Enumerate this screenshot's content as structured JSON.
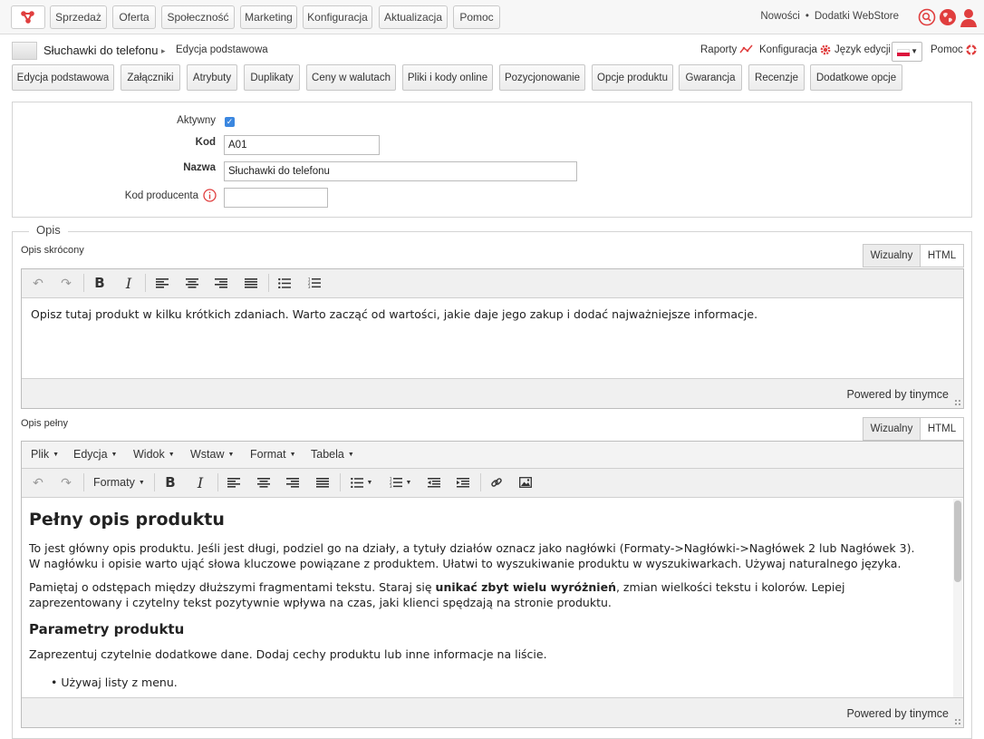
{
  "topnav": {
    "items": [
      "Sprzedaż",
      "Oferta",
      "Społeczność",
      "Marketing",
      "Konfiguracja",
      "Aktualizacja",
      "Pomoc"
    ],
    "news": "Nowości",
    "separator": "•",
    "addons": "Dodatki WebStore",
    "icons": [
      "logo-icon",
      "search-icon",
      "globe-icon",
      "user-icon"
    ],
    "accent": "#e03e3e"
  },
  "product_header": {
    "name": "Słuchawki do telefonu",
    "arrow": "▸",
    "section": "Edycja podstawowa",
    "reports": "Raporty",
    "config": "Konfiguracja",
    "lang_label": "Język edycji",
    "help": "Pomoc"
  },
  "tabs": [
    "Edycja podstawowa",
    "Załączniki",
    "Atrybuty",
    "Duplikaty",
    "Ceny w walutach",
    "Pliki i kody online",
    "Pozycjonowanie",
    "Opcje produktu",
    "Gwarancja",
    "Recenzje",
    "Dodatkowe opcje"
  ],
  "form": {
    "active_label": "Aktywny",
    "active_checked": true,
    "code_label": "Kod",
    "code_value": "A01",
    "name_label": "Nazwa",
    "name_value": "Słuchawki do telefonu",
    "producer_code_label": "Kod producenta",
    "producer_code_value": ""
  },
  "opis": {
    "legend": "Opis",
    "short": {
      "label": "Opis skrócony",
      "mode_visual": "Wizualny",
      "mode_html": "HTML",
      "text": "Opisz tutaj produkt w kilku krótkich zdaniach. Warto zacząć od wartości, jakie daje jego zakup i dodać najważniejsze informacje.",
      "powered": "Powered by tinymce"
    },
    "full": {
      "label": "Opis pełny",
      "mode_visual": "Wizualny",
      "mode_html": "HTML",
      "menu": [
        "Plik",
        "Edycja",
        "Widok",
        "Wstaw",
        "Format",
        "Tabela"
      ],
      "formats": "Formaty",
      "heading": "Pełny opis produktu",
      "p1": "To jest główny opis produktu. Jeśli jest długi, podziel go na działy, a tytuły działów oznacz jako nagłówki (Formaty->Nagłówki->Nagłówek 2 lub Nagłówek 3). W nagłówku i opisie warto ująć słowa kluczowe powiązane z produktem. Ułatwi to wyszukiwanie produktu w wyszukiwarkach. Używaj naturalnego języka.",
      "p2_before": "Pamiętaj o odstępach między dłuższymi fragmentami tekstu. Staraj się ",
      "p2_bold": "unikać zbyt wielu wyróżnień",
      "p2_after": ", zmian wielkości tekstu i kolorów. Lepiej zaprezentowany i czytelny tekst pozytywnie wpływa na czas, jaki klienci spędzają na stronie produktu.",
      "h2": "Parametry produktu",
      "p3": "Zaprezentuj czytelnie dodatkowe dane. Dodaj cechy produktu lub inne informacje na liście.",
      "li1": "Używaj listy z menu.",
      "powered": "Powered by tinymce"
    }
  }
}
